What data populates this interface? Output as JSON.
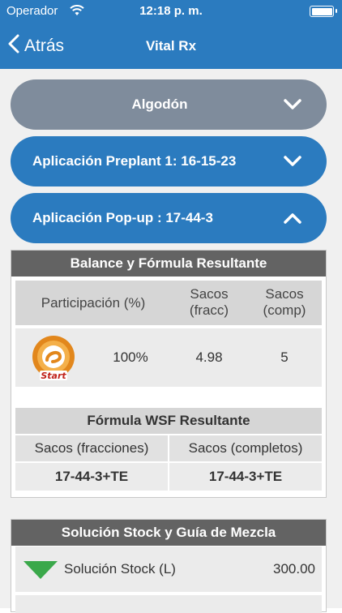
{
  "status_bar": {
    "carrier": "Operador",
    "time": "12:18 p. m."
  },
  "nav": {
    "back_label": "Atrás",
    "title": "Vital Rx"
  },
  "accordions": [
    {
      "label": "Algodón",
      "state": "collapsed",
      "color": "#7f8c9c"
    },
    {
      "label": "Aplicación Preplant 1: 16-15-23",
      "state": "collapsed",
      "color": "#2b7bbf"
    },
    {
      "label": "Aplicación Pop-up : 17-44-3",
      "state": "expanded",
      "color": "#2b7bbf"
    }
  ],
  "balance_card": {
    "title": "Balance y Fórmula Resultante",
    "headers": {
      "participation": "Participación (%)",
      "sacos_fracc": "Sacos\n(fracc)",
      "sacos_comp": "Sacos\n(comp)"
    },
    "row": {
      "logo_icon": "start-product-logo",
      "participation": "100%",
      "sacos_fracc": "4.98",
      "sacos_comp": "5"
    },
    "wsf_title": "Fórmula WSF Resultante",
    "wsf_headers": [
      "Sacos (fracciones)",
      "Sacos (completos)"
    ],
    "wsf_values": [
      "17-44-3+TE",
      "17-44-3+TE"
    ]
  },
  "stock_card": {
    "title": "Solución Stock y Guía de Mezcla",
    "row": {
      "icon": "triangle-down-icon",
      "label": "Solución Stock (L)",
      "value": "300.00"
    }
  }
}
